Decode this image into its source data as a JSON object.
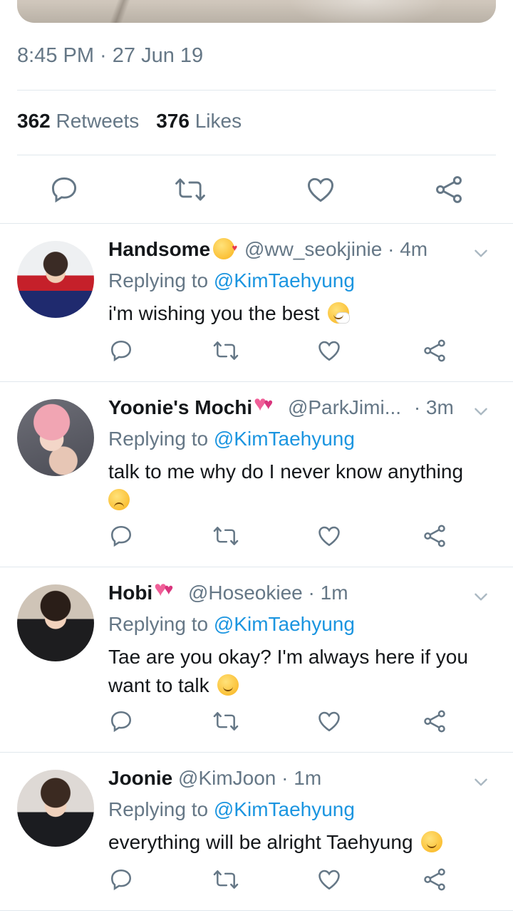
{
  "tweet": {
    "timestamp": "8:45 PM · 27 Jun 19",
    "retweets_count": "362",
    "retweets_label": "Retweets",
    "likes_count": "376",
    "likes_label": "Likes"
  },
  "replies": [
    {
      "name": "Handsome",
      "name_emoji": "kissing-face-emoji",
      "handle": "@ww_seokjinie",
      "time": "· 4m",
      "replying_prefix": "Replying to",
      "replying_to": "@KimTaehyung",
      "text": "i'm wishing you the best",
      "text_emoji": "sneezing-face-emoji"
    },
    {
      "name": "Yoonie's Mochi",
      "name_emoji": "two-hearts-emoji",
      "handle": "@ParkJimi...",
      "time": "· 3m",
      "replying_prefix": "Replying to",
      "replying_to": "@KimTaehyung",
      "text": "talk to me why do I never know anything",
      "text_emoji": "frowning-face-emoji"
    },
    {
      "name": "Hobi",
      "name_emoji": "two-hearts-emoji",
      "handle": "@Hoseokiee",
      "time": "· 1m",
      "replying_prefix": "Replying to",
      "replying_to": "@KimTaehyung",
      "text": "Tae are you okay? I'm always here if you want to talk",
      "text_emoji": "smiling-face-emoji"
    },
    {
      "name": "Joonie",
      "handle": "@KimJoon",
      "time": "· 1m",
      "replying_prefix": "Replying to",
      "replying_to": "@KimTaehyung",
      "text": "everything will be alright Taehyung",
      "text_emoji": "relieved-face-emoji"
    }
  ],
  "colors": {
    "text_primary": "#14171a",
    "text_secondary": "#657786",
    "link": "#1b95e0",
    "divider": "#e1e8ed"
  },
  "icons": [
    "reply-icon",
    "retweet-icon",
    "like-icon",
    "share-icon",
    "chevron-down-icon"
  ]
}
